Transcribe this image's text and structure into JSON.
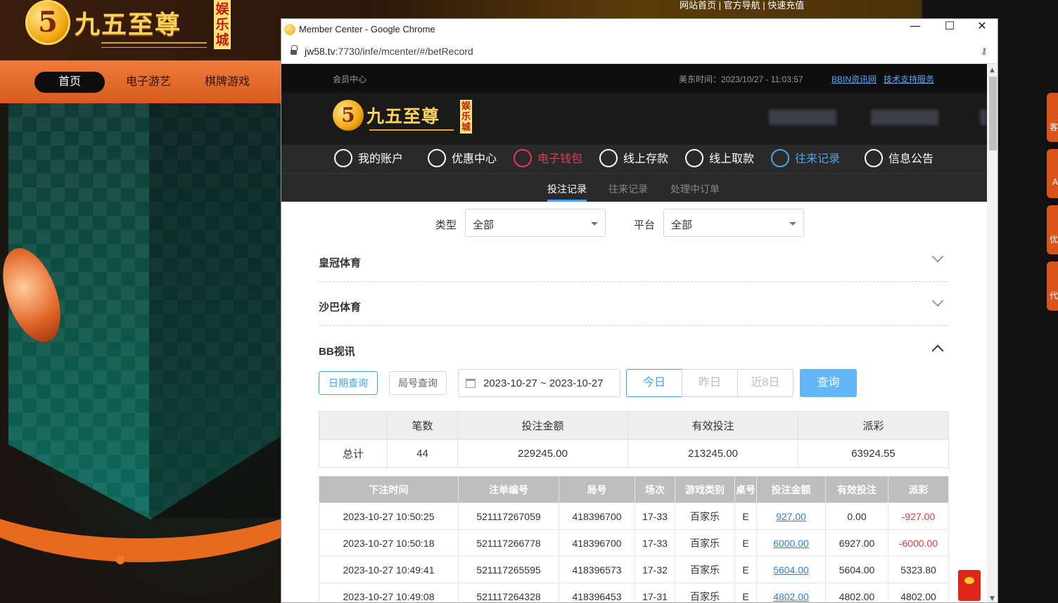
{
  "bg": {
    "logo": {
      "glyph": "5",
      "name": "九五至尊",
      "tag": "娱乐城"
    },
    "top_links": "网站首页 | 官方导航 | 快速充值",
    "nav": [
      "首页",
      "电子游艺",
      "棋牌游戏"
    ],
    "right_tabs": [
      "客",
      "A",
      "优",
      "代"
    ]
  },
  "window": {
    "title": "Member Center - Google Chrome",
    "url_host": "jw58.tv",
    "url_rest": ":7730/infe/mcenter/#/betRecord",
    "controls": {
      "minimize": "—",
      "maximize": "☐",
      "close": "✕"
    }
  },
  "mc": {
    "label": "会员中心",
    "time": "美东时间：2023/10/27 - 11:03:57",
    "links": [
      "BBIN资讯网",
      "技术支持服务"
    ],
    "logo": {
      "glyph": "5",
      "name": "九五至尊",
      "tag": "娱乐城"
    },
    "nav": [
      "我的账户",
      "优惠中心",
      "电子钱包",
      "线上存款",
      "线上取款",
      "往来记录",
      "信息公告"
    ],
    "subnav": [
      "投注记录",
      "往来记录",
      "处理中订单"
    ]
  },
  "filters": {
    "type_label": "类型",
    "type_value": "全部",
    "platform_label": "平台",
    "platform_value": "全部"
  },
  "sections": [
    "皇冠体育",
    "沙巴体育",
    "BB视讯"
  ],
  "query": {
    "date_btn": "日期查询",
    "round_btn": "局号查询",
    "range": "2023-10-27 ~ 2023-10-27",
    "quick": [
      "今日",
      "昨日",
      "近8日"
    ],
    "search": "查询"
  },
  "summary": {
    "headers": [
      "",
      "笔数",
      "投注金额",
      "有效投注",
      "派彩"
    ],
    "row": [
      "总计",
      "44",
      "229245.00",
      "213245.00",
      "63924.55"
    ]
  },
  "detail": {
    "headers": [
      "下注时间",
      "注单编号",
      "局号",
      "场次",
      "游戏类别",
      "桌号",
      "投注金额",
      "有效投注",
      "派彩"
    ],
    "rows": [
      [
        "2023-10-27 10:50:25",
        "521117267059",
        "418396700",
        "17-33",
        "百家乐",
        "E",
        "927.00",
        "0.00",
        "-927.00"
      ],
      [
        "2023-10-27 10:50:18",
        "521117266778",
        "418396700",
        "17-33",
        "百家乐",
        "E",
        "6000.00",
        "6927.00",
        "-6000.00"
      ],
      [
        "2023-10-27 10:49:41",
        "521117265595",
        "418396573",
        "17-32",
        "百家乐",
        "E",
        "5604.00",
        "5604.00",
        "5323.80"
      ],
      [
        "2023-10-27 10:49:08",
        "521117264328",
        "418396453",
        "17-31",
        "百家乐",
        "E",
        "4802.00",
        "4802.00",
        "4802.00"
      ]
    ]
  }
}
